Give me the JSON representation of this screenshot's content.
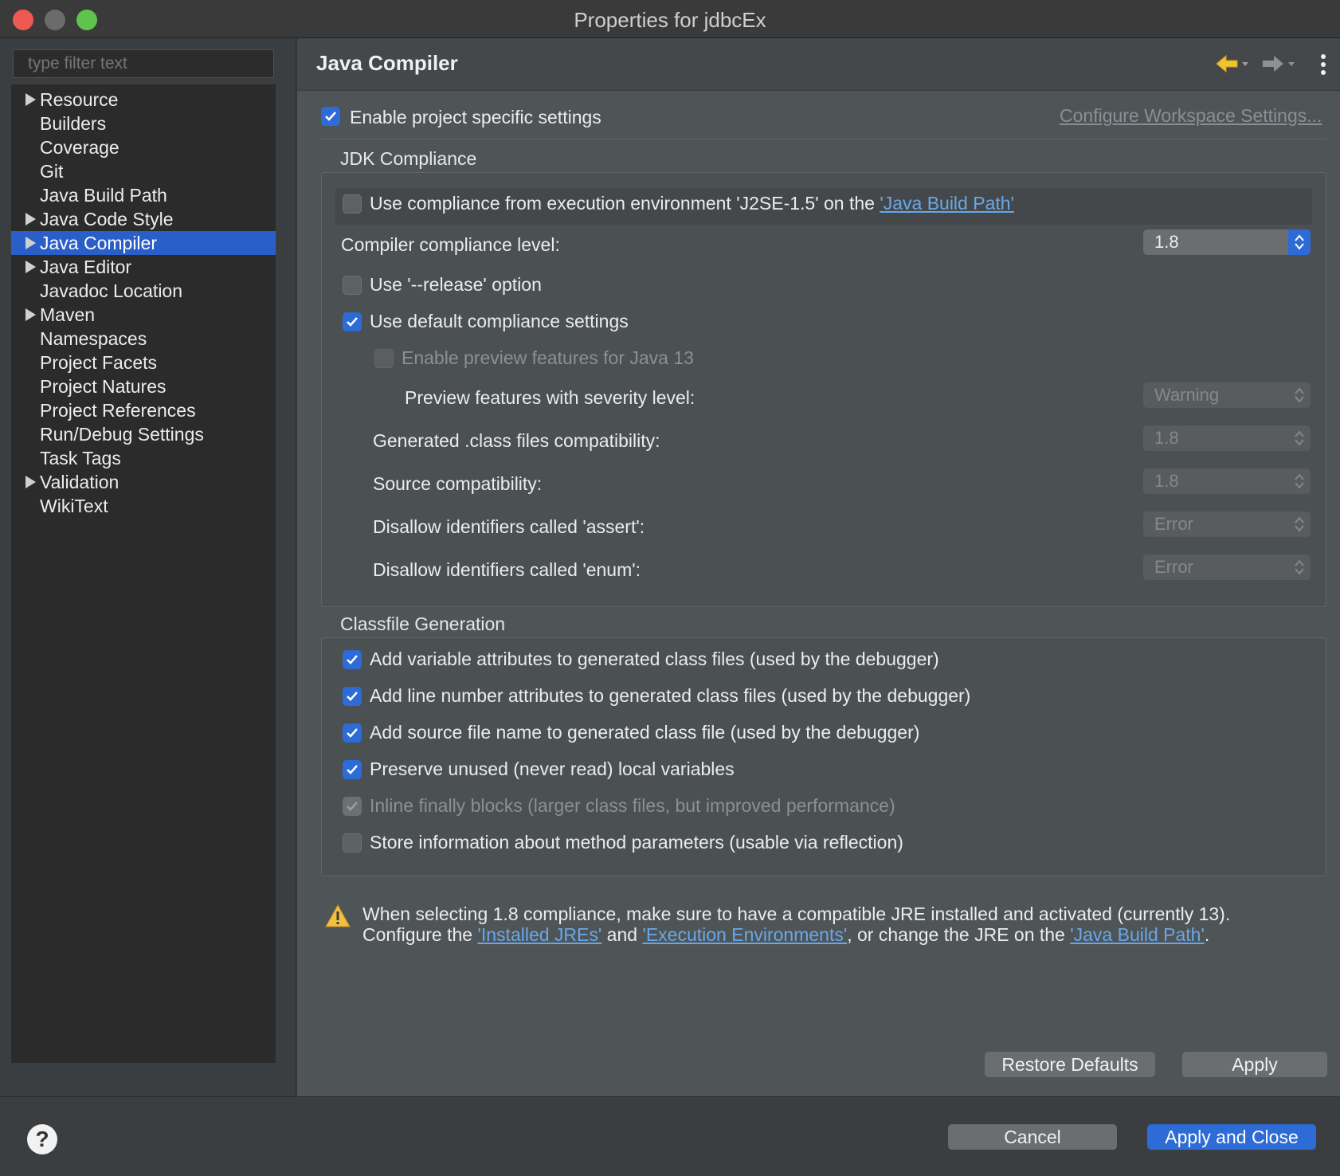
{
  "window": {
    "title": "Properties for jdbcEx"
  },
  "filter": {
    "placeholder": "type filter text"
  },
  "tree": {
    "items": [
      {
        "label": "Resource",
        "expandable": true,
        "selected": false
      },
      {
        "label": "Builders",
        "expandable": false,
        "selected": false
      },
      {
        "label": "Coverage",
        "expandable": false,
        "selected": false
      },
      {
        "label": "Git",
        "expandable": false,
        "selected": false
      },
      {
        "label": "Java Build Path",
        "expandable": false,
        "selected": false
      },
      {
        "label": "Java Code Style",
        "expandable": true,
        "selected": false
      },
      {
        "label": "Java Compiler",
        "expandable": true,
        "selected": true
      },
      {
        "label": "Java Editor",
        "expandable": true,
        "selected": false
      },
      {
        "label": "Javadoc Location",
        "expandable": false,
        "selected": false
      },
      {
        "label": "Maven",
        "expandable": true,
        "selected": false
      },
      {
        "label": "Namespaces",
        "expandable": false,
        "selected": false
      },
      {
        "label": "Project Facets",
        "expandable": false,
        "selected": false
      },
      {
        "label": "Project Natures",
        "expandable": false,
        "selected": false
      },
      {
        "label": "Project References",
        "expandable": false,
        "selected": false
      },
      {
        "label": "Run/Debug Settings",
        "expandable": false,
        "selected": false
      },
      {
        "label": "Task Tags",
        "expandable": false,
        "selected": false
      },
      {
        "label": "Validation",
        "expandable": true,
        "selected": false
      },
      {
        "label": "WikiText",
        "expandable": false,
        "selected": false
      }
    ]
  },
  "page": {
    "title": "Java Compiler",
    "enable_specific": {
      "label": "Enable project specific settings",
      "checked": true
    },
    "configure_link": "Configure Workspace Settings...",
    "jdk": {
      "title": "JDK Compliance",
      "use_env_prefix": "Use compliance from execution environment 'J2SE-1.5' on the ",
      "use_env_link": "'Java Build Path'",
      "use_env_checked": false,
      "compliance_label": "Compiler compliance level:",
      "compliance_value": "1.8",
      "release_label": "Use '--release' option",
      "release_checked": false,
      "default_label": "Use default compliance settings",
      "default_checked": true,
      "preview_label": "Enable preview features for Java 13",
      "preview_checked": false,
      "severity_label": "Preview features with severity level:",
      "severity_value": "Warning",
      "class_compat_label": "Generated .class files compatibility:",
      "class_compat_value": "1.8",
      "source_compat_label": "Source compatibility:",
      "source_compat_value": "1.8",
      "assert_label": "Disallow identifiers called 'assert':",
      "assert_value": "Error",
      "enum_label": "Disallow identifiers called 'enum':",
      "enum_value": "Error"
    },
    "classfile": {
      "title": "Classfile Generation",
      "options": [
        {
          "label": "Add variable attributes to generated class files (used by the debugger)",
          "checked": true,
          "enabled": true
        },
        {
          "label": "Add line number attributes to generated class files (used by the debugger)",
          "checked": true,
          "enabled": true
        },
        {
          "label": "Add source file name to generated class file (used by the debugger)",
          "checked": true,
          "enabled": true
        },
        {
          "label": "Preserve unused (never read) local variables",
          "checked": true,
          "enabled": true
        },
        {
          "label": "Inline finally blocks (larger class files, but improved performance)",
          "checked": true,
          "enabled": false
        },
        {
          "label": "Store information about method parameters (usable via reflection)",
          "checked": false,
          "enabled": true
        }
      ]
    },
    "warning": {
      "line1": "When selecting 1.8 compliance, make sure to have a compatible JRE installed and activated (currently 13).",
      "line2_a": "Configure the ",
      "link_jres": "'Installed JREs'",
      "line2_b": " and ",
      "link_envs": "'Execution Environments'",
      "line2_c": ", or change the JRE on the ",
      "link_build_path": "'Java Build Path'",
      "line2_d": "."
    },
    "restore_defaults": "Restore Defaults",
    "apply": "Apply"
  },
  "footer": {
    "cancel": "Cancel",
    "apply_close": "Apply and Close",
    "help": "?"
  },
  "colors": {
    "accent": "#2d6bd6",
    "link": "#68a8e8",
    "warning": "#f0c040"
  },
  "icons": [
    "back-arrow-icon",
    "forward-arrow-icon",
    "more-vertical-icon",
    "warning-icon",
    "help-icon",
    "chevron-updown-icon",
    "checkmark-icon"
  ]
}
